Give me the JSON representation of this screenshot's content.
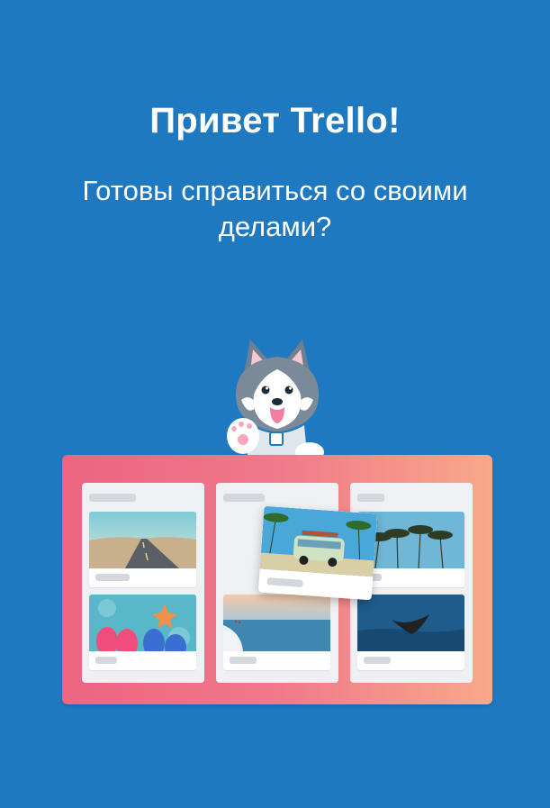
{
  "welcome": {
    "title": "Привет Trello!",
    "subtitle": "Готовы справиться со своими делами?"
  },
  "illustration": {
    "mascot": "husky-mascot",
    "board_colors": [
      "#ec6581",
      "#f8a88a"
    ],
    "images": [
      "road-photo",
      "flip-flops-starfish-photo",
      "sea-shore-photo",
      "van-palms-photo",
      "palm-trees-photo",
      "whale-tail-photo"
    ]
  },
  "colors": {
    "background": "#1f79c0",
    "title": "#ffffff"
  }
}
